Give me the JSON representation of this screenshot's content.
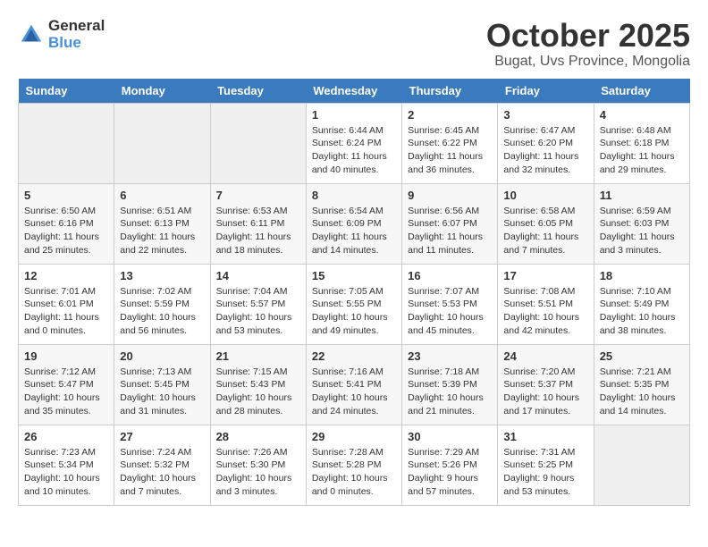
{
  "header": {
    "logo_general": "General",
    "logo_blue": "Blue",
    "month": "October 2025",
    "location": "Bugat, Uvs Province, Mongolia"
  },
  "days_of_week": [
    "Sunday",
    "Monday",
    "Tuesday",
    "Wednesday",
    "Thursday",
    "Friday",
    "Saturday"
  ],
  "weeks": [
    [
      {
        "day": "",
        "info": ""
      },
      {
        "day": "",
        "info": ""
      },
      {
        "day": "",
        "info": ""
      },
      {
        "day": "1",
        "info": "Sunrise: 6:44 AM\nSunset: 6:24 PM\nDaylight: 11 hours\nand 40 minutes."
      },
      {
        "day": "2",
        "info": "Sunrise: 6:45 AM\nSunset: 6:22 PM\nDaylight: 11 hours\nand 36 minutes."
      },
      {
        "day": "3",
        "info": "Sunrise: 6:47 AM\nSunset: 6:20 PM\nDaylight: 11 hours\nand 32 minutes."
      },
      {
        "day": "4",
        "info": "Sunrise: 6:48 AM\nSunset: 6:18 PM\nDaylight: 11 hours\nand 29 minutes."
      }
    ],
    [
      {
        "day": "5",
        "info": "Sunrise: 6:50 AM\nSunset: 6:16 PM\nDaylight: 11 hours\nand 25 minutes."
      },
      {
        "day": "6",
        "info": "Sunrise: 6:51 AM\nSunset: 6:13 PM\nDaylight: 11 hours\nand 22 minutes."
      },
      {
        "day": "7",
        "info": "Sunrise: 6:53 AM\nSunset: 6:11 PM\nDaylight: 11 hours\nand 18 minutes."
      },
      {
        "day": "8",
        "info": "Sunrise: 6:54 AM\nSunset: 6:09 PM\nDaylight: 11 hours\nand 14 minutes."
      },
      {
        "day": "9",
        "info": "Sunrise: 6:56 AM\nSunset: 6:07 PM\nDaylight: 11 hours\nand 11 minutes."
      },
      {
        "day": "10",
        "info": "Sunrise: 6:58 AM\nSunset: 6:05 PM\nDaylight: 11 hours\nand 7 minutes."
      },
      {
        "day": "11",
        "info": "Sunrise: 6:59 AM\nSunset: 6:03 PM\nDaylight: 11 hours\nand 3 minutes."
      }
    ],
    [
      {
        "day": "12",
        "info": "Sunrise: 7:01 AM\nSunset: 6:01 PM\nDaylight: 11 hours\nand 0 minutes."
      },
      {
        "day": "13",
        "info": "Sunrise: 7:02 AM\nSunset: 5:59 PM\nDaylight: 10 hours\nand 56 minutes."
      },
      {
        "day": "14",
        "info": "Sunrise: 7:04 AM\nSunset: 5:57 PM\nDaylight: 10 hours\nand 53 minutes."
      },
      {
        "day": "15",
        "info": "Sunrise: 7:05 AM\nSunset: 5:55 PM\nDaylight: 10 hours\nand 49 minutes."
      },
      {
        "day": "16",
        "info": "Sunrise: 7:07 AM\nSunset: 5:53 PM\nDaylight: 10 hours\nand 45 minutes."
      },
      {
        "day": "17",
        "info": "Sunrise: 7:08 AM\nSunset: 5:51 PM\nDaylight: 10 hours\nand 42 minutes."
      },
      {
        "day": "18",
        "info": "Sunrise: 7:10 AM\nSunset: 5:49 PM\nDaylight: 10 hours\nand 38 minutes."
      }
    ],
    [
      {
        "day": "19",
        "info": "Sunrise: 7:12 AM\nSunset: 5:47 PM\nDaylight: 10 hours\nand 35 minutes."
      },
      {
        "day": "20",
        "info": "Sunrise: 7:13 AM\nSunset: 5:45 PM\nDaylight: 10 hours\nand 31 minutes."
      },
      {
        "day": "21",
        "info": "Sunrise: 7:15 AM\nSunset: 5:43 PM\nDaylight: 10 hours\nand 28 minutes."
      },
      {
        "day": "22",
        "info": "Sunrise: 7:16 AM\nSunset: 5:41 PM\nDaylight: 10 hours\nand 24 minutes."
      },
      {
        "day": "23",
        "info": "Sunrise: 7:18 AM\nSunset: 5:39 PM\nDaylight: 10 hours\nand 21 minutes."
      },
      {
        "day": "24",
        "info": "Sunrise: 7:20 AM\nSunset: 5:37 PM\nDaylight: 10 hours\nand 17 minutes."
      },
      {
        "day": "25",
        "info": "Sunrise: 7:21 AM\nSunset: 5:35 PM\nDaylight: 10 hours\nand 14 minutes."
      }
    ],
    [
      {
        "day": "26",
        "info": "Sunrise: 7:23 AM\nSunset: 5:34 PM\nDaylight: 10 hours\nand 10 minutes."
      },
      {
        "day": "27",
        "info": "Sunrise: 7:24 AM\nSunset: 5:32 PM\nDaylight: 10 hours\nand 7 minutes."
      },
      {
        "day": "28",
        "info": "Sunrise: 7:26 AM\nSunset: 5:30 PM\nDaylight: 10 hours\nand 3 minutes."
      },
      {
        "day": "29",
        "info": "Sunrise: 7:28 AM\nSunset: 5:28 PM\nDaylight: 10 hours\nand 0 minutes."
      },
      {
        "day": "30",
        "info": "Sunrise: 7:29 AM\nSunset: 5:26 PM\nDaylight: 9 hours\nand 57 minutes."
      },
      {
        "day": "31",
        "info": "Sunrise: 7:31 AM\nSunset: 5:25 PM\nDaylight: 9 hours\nand 53 minutes."
      },
      {
        "day": "",
        "info": ""
      }
    ]
  ]
}
